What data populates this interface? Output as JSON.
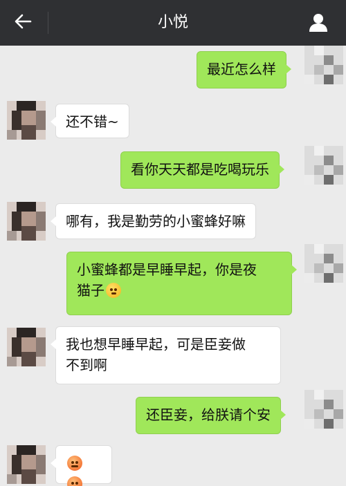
{
  "header": {
    "title": "小悦",
    "back_icon": "arrow-left-icon",
    "profile_icon": "person-icon"
  },
  "colors": {
    "topbar": "#2f3033",
    "chat_background": "#ebebeb",
    "outgoing_bubble": "#a0e75a",
    "incoming_bubble": "#ffffff"
  },
  "messages": [
    {
      "direction": "outgoing",
      "lines": [
        "最近怎么样"
      ]
    },
    {
      "direction": "incoming",
      "lines": [
        "还不错~"
      ]
    },
    {
      "direction": "outgoing",
      "lines": [
        "看你天天都是吃喝玩乐"
      ]
    },
    {
      "direction": "incoming",
      "lines": [
        "哪有，我是勤劳的小蜜蜂好嘛"
      ]
    },
    {
      "direction": "outgoing",
      "lines": [
        "小蜜蜂都是早睡早起，你是夜",
        "猫子"
      ],
      "emoji": "thinking-face-emoji"
    },
    {
      "direction": "incoming",
      "lines": [
        "我也想早睡早起，可是臣妾做",
        "不到啊"
      ]
    },
    {
      "direction": "outgoing",
      "lines": [
        "还臣妾，给朕请个安"
      ]
    },
    {
      "direction": "incoming",
      "lines": [],
      "emoji": "angry-face-emoji"
    }
  ]
}
